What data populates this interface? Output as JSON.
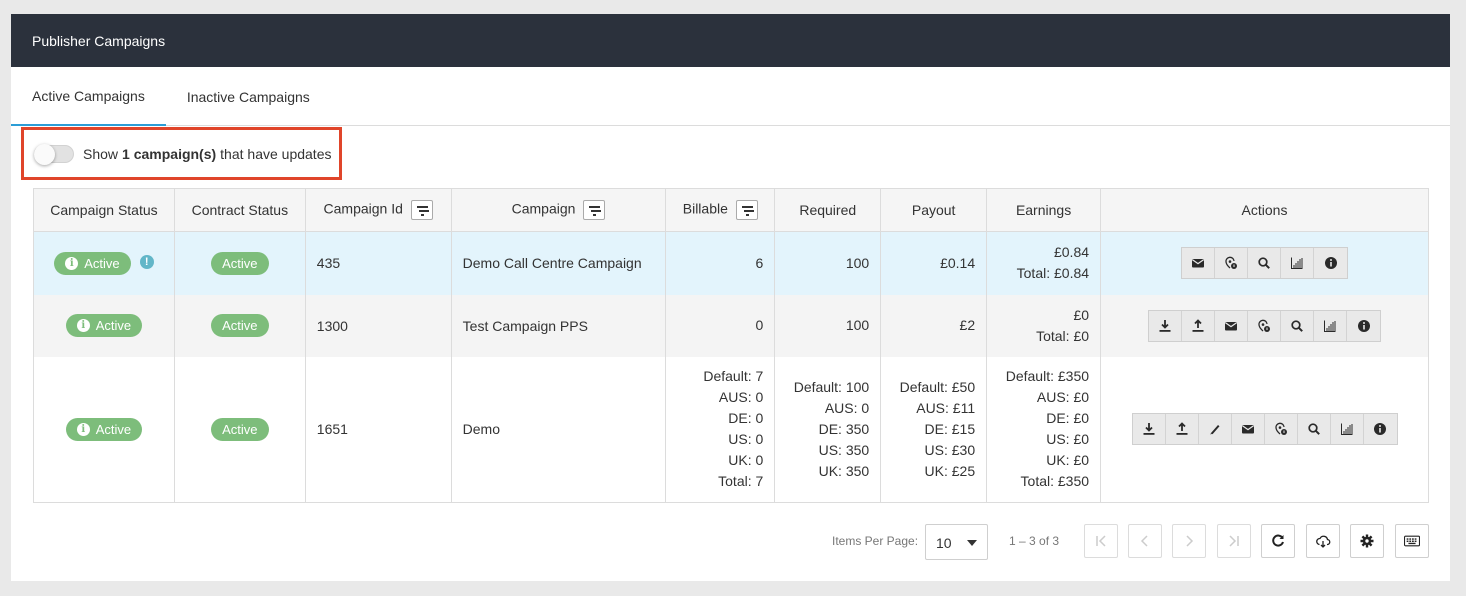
{
  "panel": {
    "title": "Publisher Campaigns"
  },
  "tabs": [
    {
      "label": "Active Campaigns",
      "active": true
    },
    {
      "label": "Inactive Campaigns",
      "active": false
    }
  ],
  "updates_toggle": {
    "prefix": "Show",
    "count_text": "1 campaign(s)",
    "suffix": "that have updates",
    "enabled": false
  },
  "table": {
    "columns": [
      "Campaign Status",
      "Contract Status",
      "Campaign Id",
      "Campaign",
      "Billable",
      "Required",
      "Payout",
      "Earnings",
      "Actions"
    ],
    "rows": [
      {
        "campaign_status": "Active",
        "has_update_alert": true,
        "contract_status": "Active",
        "campaign_id": "435",
        "campaign": "Demo Call Centre Campaign",
        "billable": [
          "6"
        ],
        "required": [
          "100"
        ],
        "payout": [
          "£0.14"
        ],
        "earnings": [
          "£0.84",
          "Total: £0.84"
        ],
        "actions": [
          "mail-icon",
          "geo-icon",
          "search-icon",
          "chart-icon",
          "info-icon"
        ]
      },
      {
        "campaign_status": "Active",
        "has_update_alert": false,
        "contract_status": "Active",
        "campaign_id": "1300",
        "campaign": "Test Campaign PPS",
        "billable": [
          "0"
        ],
        "required": [
          "100"
        ],
        "payout": [
          "£2"
        ],
        "earnings": [
          "£0",
          "Total: £0"
        ],
        "actions": [
          "download-icon",
          "upload-icon",
          "mail-icon",
          "geo-icon",
          "search-icon",
          "chart-icon",
          "info-icon"
        ]
      },
      {
        "campaign_status": "Active",
        "has_update_alert": false,
        "contract_status": "Active",
        "campaign_id": "1651",
        "campaign": "Demo",
        "billable": [
          "Default: 7",
          "AUS: 0",
          "DE: 0",
          "US: 0",
          "UK: 0",
          "Total: 7"
        ],
        "required": [
          "Default: 100",
          "AUS: 0",
          "DE: 350",
          "US: 350",
          "UK: 350"
        ],
        "payout": [
          "Default: £50",
          "AUS: £11",
          "DE: £15",
          "US: £30",
          "UK: £25"
        ],
        "earnings": [
          "Default: £350",
          "AUS: £0",
          "DE: £0",
          "US: £0",
          "UK: £0",
          "Total: £350"
        ],
        "actions": [
          "download-icon",
          "upload-icon",
          "pencil-icon",
          "mail-icon",
          "geo-icon",
          "search-icon",
          "chart-icon",
          "info-icon"
        ]
      }
    ]
  },
  "pager": {
    "items_per_page_label": "Items Per Page:",
    "items_per_page": "10",
    "range": "1 – 3 of 3"
  },
  "colors": {
    "header_bg": "#2b313c",
    "active_badge": "#7dbd7b",
    "highlight_row": "#e3f4fc",
    "annotation_border": "#e0452a",
    "tab_underline": "#2b9dd6"
  }
}
